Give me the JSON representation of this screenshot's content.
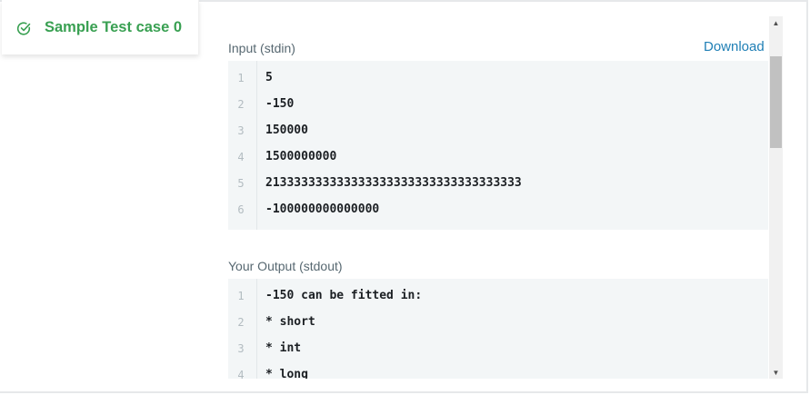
{
  "tab": {
    "label": "Sample Test case 0",
    "icon": "check-circle-icon",
    "status_color": "#39a052"
  },
  "input": {
    "label": "Input (stdin)",
    "download_label": "Download",
    "lines": [
      {
        "n": "1",
        "text": "5"
      },
      {
        "n": "2",
        "text": "-150"
      },
      {
        "n": "3",
        "text": "150000"
      },
      {
        "n": "4",
        "text": "1500000000"
      },
      {
        "n": "5",
        "text": "213333333333333333333333333333333333"
      },
      {
        "n": "6",
        "text": "-100000000000000"
      }
    ]
  },
  "output": {
    "label": "Your Output (stdout)",
    "lines": [
      {
        "n": "1",
        "text": "-150 can be fitted in:"
      },
      {
        "n": "2",
        "text": "* short"
      },
      {
        "n": "3",
        "text": "* int"
      },
      {
        "n": "4",
        "text": "* long"
      }
    ]
  },
  "scrollbar": {
    "up_icon": "arrow-up-icon",
    "down_icon": "arrow-down-icon"
  }
}
